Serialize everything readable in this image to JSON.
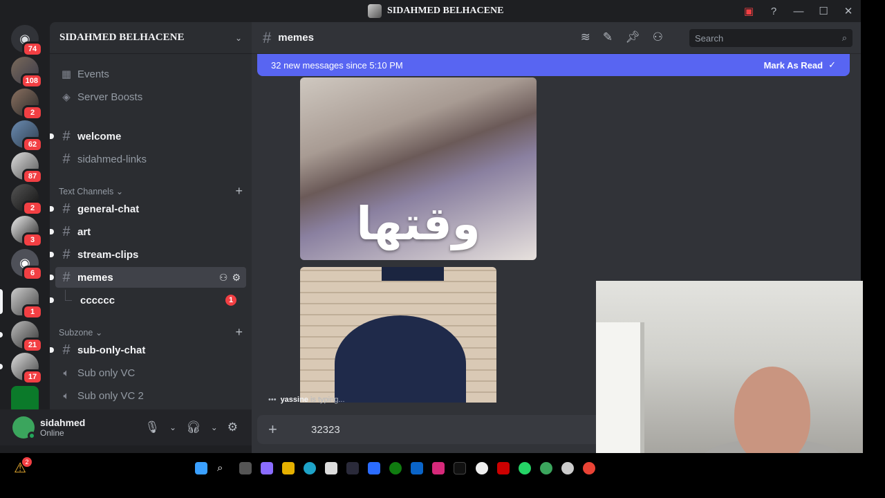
{
  "window": {
    "title": "SIDAHMED BELHACENE"
  },
  "guilds": [
    {
      "name": "discord-home",
      "badge": "74"
    },
    {
      "name": "server-1",
      "badge": "108"
    },
    {
      "name": "server-2",
      "badge": "2"
    },
    {
      "name": "server-3",
      "badge": "62"
    },
    {
      "name": "server-4",
      "badge": "87"
    },
    {
      "name": "server-5",
      "badge": "2"
    },
    {
      "name": "server-6",
      "badge": "3"
    },
    {
      "name": "server-7",
      "badge": "6"
    },
    {
      "name": "server-8",
      "badge": "1"
    },
    {
      "name": "server-9",
      "badge": "21"
    },
    {
      "name": "server-10",
      "badge": "17"
    }
  ],
  "sidebar": {
    "server_name": "SIDAHMED BELHACENE",
    "events": "Events",
    "boosts": "Server Boosts",
    "channels_top": [
      {
        "label": "welcome"
      },
      {
        "label": "sidahmed-links"
      }
    ],
    "categories": [
      {
        "label": "Text Channels"
      },
      {
        "label": "Subzone"
      }
    ],
    "text_channels": [
      {
        "label": "general-chat"
      },
      {
        "label": "art"
      },
      {
        "label": "stream-clips"
      },
      {
        "label": "memes"
      }
    ],
    "thread": {
      "label": "cccccc",
      "badge": "1"
    },
    "sub_channels": [
      {
        "label": "sub-only-chat"
      },
      {
        "label": "Sub only VC"
      },
      {
        "label": "Sub only VC 2"
      }
    ]
  },
  "user": {
    "name": "sidahmed",
    "status": "Online"
  },
  "channel": {
    "name": "memes",
    "search_placeholder": "Search",
    "new_messages": "32 new messages since 5:10 PM",
    "mark_read": "Mark As Read",
    "image_caption": "وقتها",
    "typing_user": "yassine",
    "typing_text": " is typing...",
    "composer_value": "32323"
  },
  "taskbar": {
    "warn_badge": "2"
  },
  "colors": {
    "accent": "#5865f2",
    "badge": "#f23f43",
    "online": "#23a55a"
  }
}
